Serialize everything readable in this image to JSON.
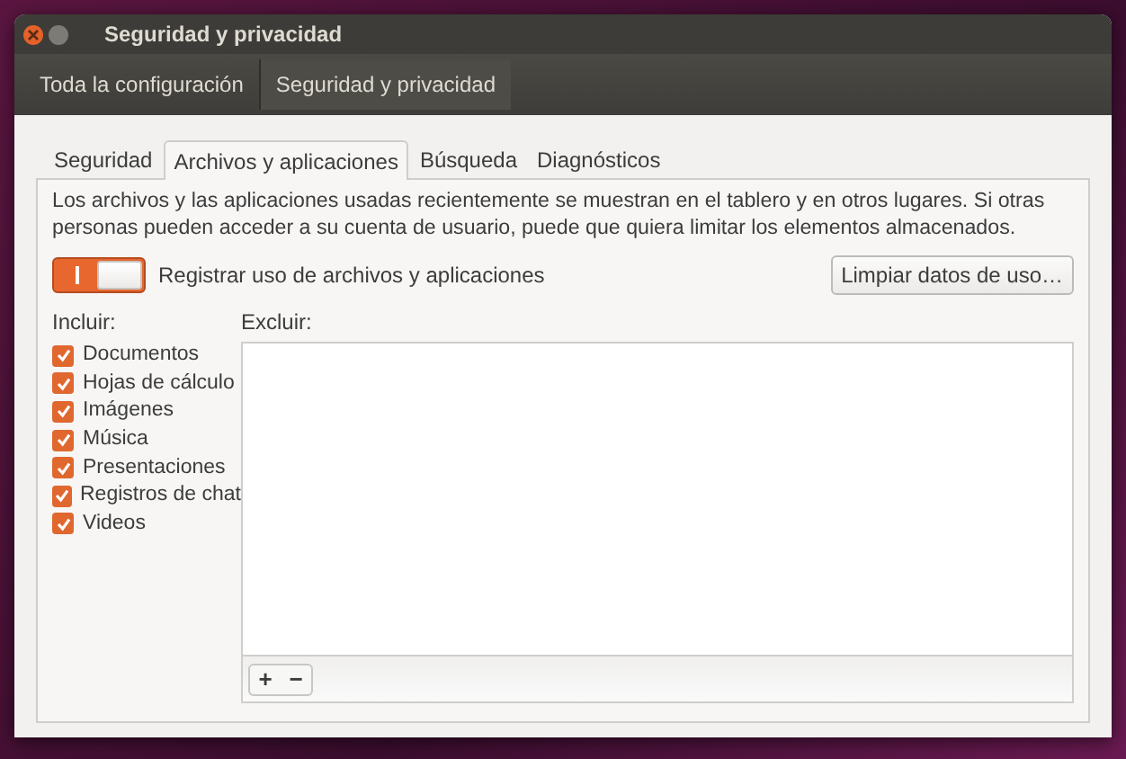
{
  "window": {
    "title": "Seguridad y privacidad"
  },
  "breadcrumbs": [
    {
      "label": "Toda la configuración",
      "selected": false
    },
    {
      "label": "Seguridad y privacidad",
      "selected": true
    }
  ],
  "tabs": [
    {
      "label": "Seguridad",
      "selected": false
    },
    {
      "label": "Archivos y aplicaciones",
      "selected": true
    },
    {
      "label": "Búsqueda",
      "selected": false
    },
    {
      "label": "Diagnósticos",
      "selected": false
    }
  ],
  "description": "Los archivos y las aplicaciones usadas recientemente se muestran en el tablero y en otros lugares. Si otras personas pueden acceder a su cuenta de usuario, puede que quiera limitar los elementos almacenados.",
  "record_switch": {
    "label": "Registrar uso de archivos y aplicaciones",
    "on": true
  },
  "clear_button": "Limpiar datos de uso…",
  "include": {
    "label": "Incluir:",
    "items": [
      {
        "label": "Documentos",
        "checked": true
      },
      {
        "label": "Hojas de cálculo",
        "checked": true
      },
      {
        "label": "Imágenes",
        "checked": true
      },
      {
        "label": "Música",
        "checked": true
      },
      {
        "label": "Presentaciones",
        "checked": true
      },
      {
        "label": "Registros de chat",
        "checked": true
      },
      {
        "label": "Videos",
        "checked": true
      }
    ]
  },
  "exclude": {
    "label": "Excluir:",
    "add_button": "+",
    "remove_button": "−"
  }
}
